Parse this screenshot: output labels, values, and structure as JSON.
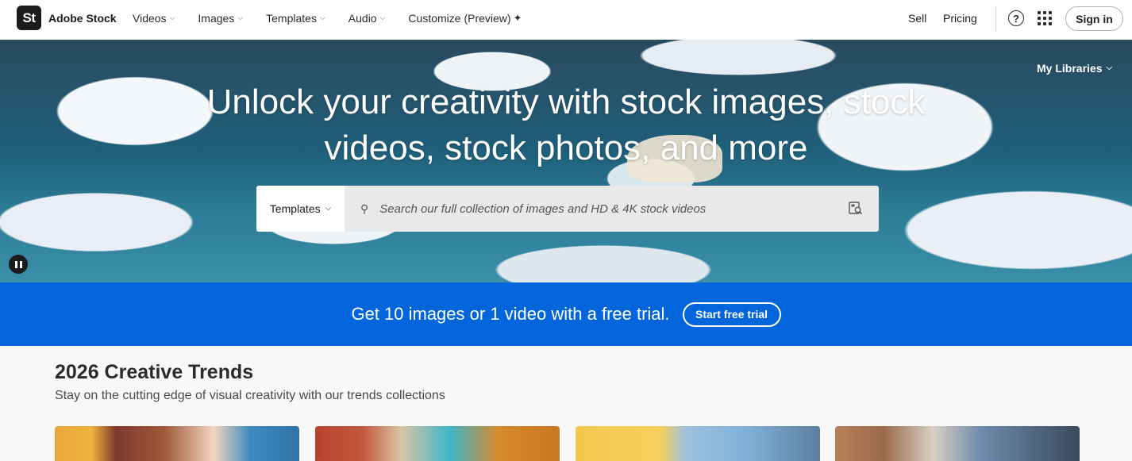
{
  "header": {
    "logo_text": "St",
    "brand": "Adobe Stock",
    "nav": [
      {
        "label": "Videos",
        "has_dropdown": true
      },
      {
        "label": "Images",
        "has_dropdown": true
      },
      {
        "label": "Templates",
        "has_dropdown": true
      },
      {
        "label": "Audio",
        "has_dropdown": true
      },
      {
        "label": "Customize (Preview)",
        "has_dropdown": false
      }
    ],
    "sell": "Sell",
    "pricing": "Pricing",
    "help_icon": "help-icon",
    "apps_icon": "apps-grid-icon",
    "sign_in": "Sign in"
  },
  "hero": {
    "title_line1": "Unlock your creativity with stock images, stock",
    "title_line2": "videos, stock photos, and more",
    "my_libraries": "My Libraries",
    "search": {
      "type_selected": "Templates",
      "placeholder": "Search our full collection of images and HD & 4K stock videos"
    }
  },
  "promo": {
    "text": "Get 10 images or 1 video with a free trial.",
    "button": "Start free trial",
    "color": "#0265dc"
  },
  "trends": {
    "title": "2026 Creative Trends",
    "subtitle": "Stay on the cutting edge of visual creativity with our trends collections"
  }
}
